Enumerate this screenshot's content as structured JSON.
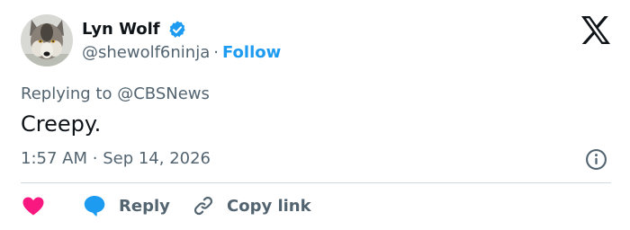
{
  "author": {
    "name": "Lyn Wolf",
    "handle": "@shewolf6ninja",
    "separator": "·",
    "follow_label": "Follow",
    "avatar_icon": "wolf-avatar-icon",
    "verified_icon": "verified-badge-icon"
  },
  "brand": {
    "logo_icon": "x-logo-icon"
  },
  "reply_context": {
    "prefix": "Replying to",
    "handle": "@CBSNews"
  },
  "tweet": {
    "text": "Creepy.",
    "time": "1:57 AM",
    "separator": "·",
    "date": "Sep 14, 2026"
  },
  "actions": {
    "like_icon": "heart-icon",
    "reply_label": "Reply",
    "reply_icon": "speech-bubble-icon",
    "copy_label": "Copy link",
    "copy_icon": "link-icon",
    "info_icon": "info-icon"
  },
  "colors": {
    "accent": "#1d9bf0",
    "like": "#f91880",
    "text": "#0f1419",
    "muted": "#536471",
    "divider": "#cfd9de"
  }
}
